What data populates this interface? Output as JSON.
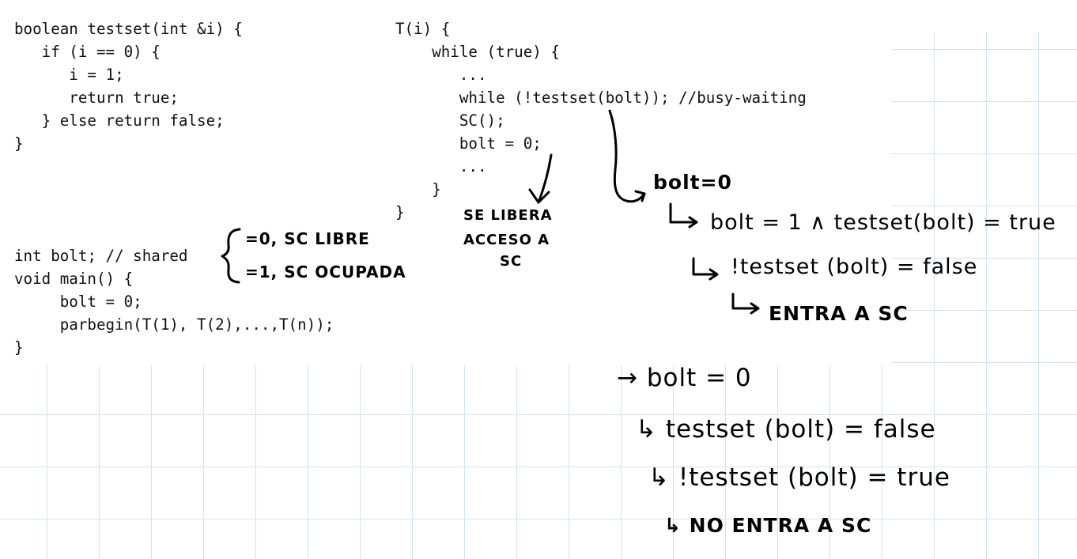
{
  "code": {
    "testset_fn": "boolean testset(int &i) {\n   if (i == 0) {\n      i = 1;\n      return true;\n   } else return false;\n}",
    "thread_fn": "T(i) {\n    while (true) {\n       ...\n       while (!testset(bolt)); //busy-waiting\n       SC();\n       bolt = 0;\n       ...\n    }\n}",
    "decl_line": "int bolt; // shared",
    "main_fn": "void main() {\n     bolt = 0;\n     parbegin(T(1), T(2),...,T(n));\n}"
  },
  "notes": {
    "brace_line1": "=0, SC LIBRE",
    "brace_line2": "=1, SC OCUPADA",
    "release_line1": "SE LIBERA",
    "release_line2": "ACCESO A",
    "release_line3": "SC",
    "case1": {
      "start": "bolt=0",
      "step1": "bolt = 1 ∧ testset(bolt) = true",
      "step2": "!testset (bolt) = false",
      "step3": "ENTRA A SC"
    },
    "case2": {
      "start": "→ bolt = 0",
      "step1": "↳ testset (bolt) = false",
      "step2": "↳ !testset (bolt) = true",
      "step3": "↳ NO ENTRA A SC"
    }
  }
}
